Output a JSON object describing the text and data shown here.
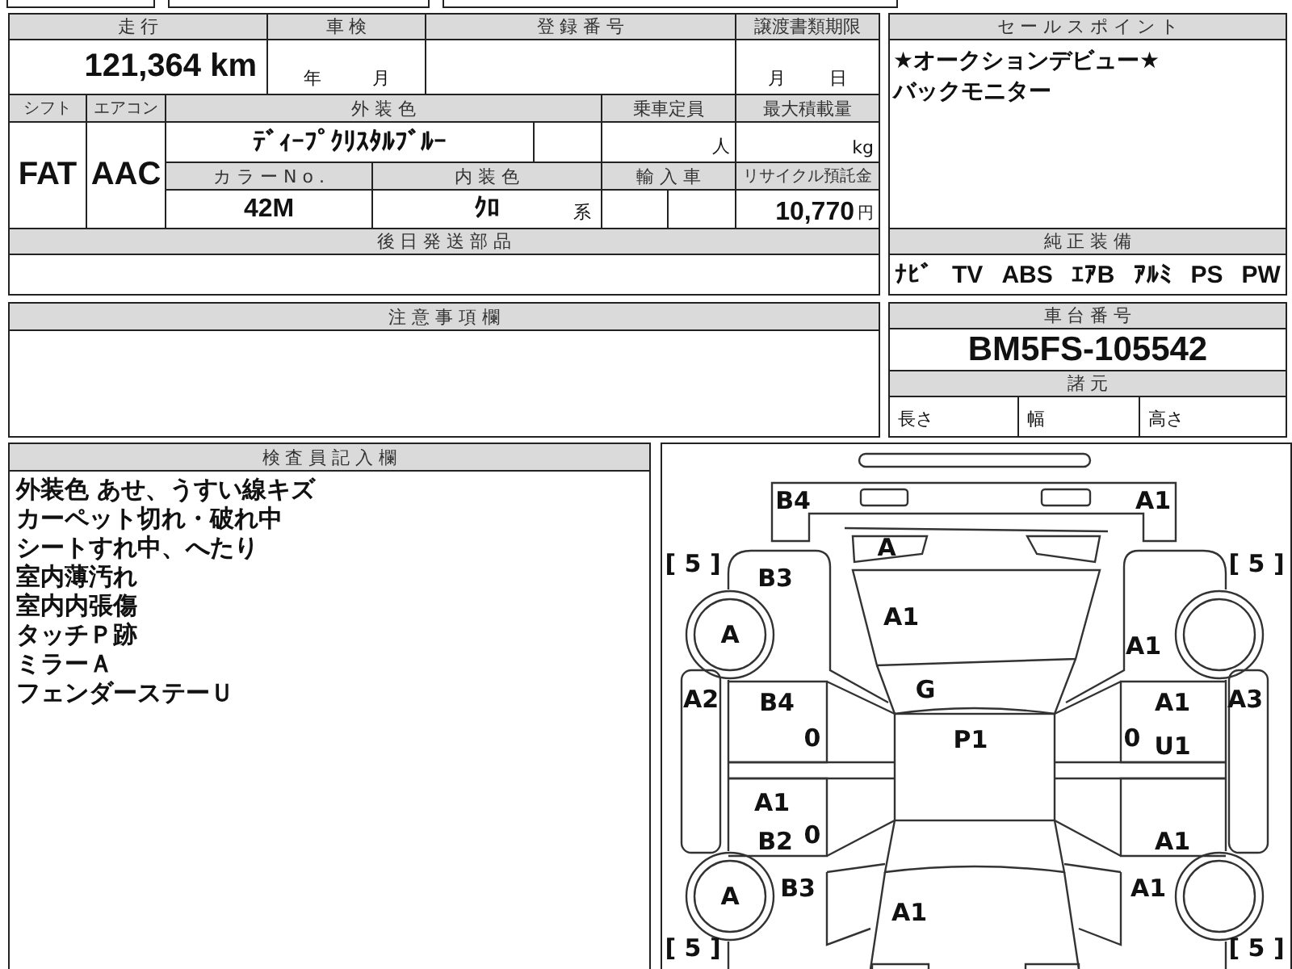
{
  "vehicle_table": {
    "mileage_label": "走 行",
    "mileage": "121,364 km",
    "inspection_label": "車 検",
    "inspection_year": "年",
    "inspection_month": "月",
    "registration_label": "登 録 番 号",
    "transfer_deadline_label": "譲渡書類期限",
    "transfer_month": "月",
    "transfer_day": "日",
    "shift_label": "シフト",
    "shift": "FAT",
    "ac_label": "エアコン",
    "ac": "AAC",
    "exterior_color_label": "外 装 色",
    "exterior_color": "ﾃﾞｨｰﾌﾟｸﾘｽﾀﾙﾌﾞﾙｰ",
    "capacity_label": "乗車定員",
    "capacity_unit": "人",
    "max_load_label": "最大積載量",
    "max_load_unit": "kg",
    "color_no_label": "カ ラ ー N o .",
    "color_no": "42M",
    "interior_color_label": "内 装 色",
    "interior_color": "ｸﾛ",
    "interior_suffix": "系",
    "import_label": "輸 入 車",
    "recycle_label": "リサイクル預託金",
    "recycle_fee": "10,770",
    "recycle_unit": "円",
    "later_parts_label": "後 日 発 送 部 品"
  },
  "sales_points": {
    "title": "セ ー ル ス ポ イ ン ト",
    "lines": [
      "★オークションデビュー★",
      "バックモニター"
    ]
  },
  "equipment": {
    "title": "純 正 装 備",
    "items": [
      "ﾅﾋﾞ",
      "TV",
      "ABS",
      "ｴｱB",
      "ｱﾙﾐ",
      "PS",
      "PW"
    ]
  },
  "notes": {
    "title": "注 意 事 項 欄"
  },
  "chassis": {
    "title": "車 台 番 号",
    "number": "BM5FS-105542",
    "specs_title": "諸 元",
    "specs": [
      "長さ",
      "幅",
      "高さ"
    ]
  },
  "inspector": {
    "title": "検 査 員 記 入 欄",
    "lines": [
      "外装色 あせ、うすい線キズ",
      "カーペット切れ・破れ中",
      "シートすれ中、へたり",
      "室内薄汚れ",
      "室内内張傷",
      "タッチＰ跡",
      "ミラーＡ",
      "フェンダーステーＵ"
    ]
  },
  "diagram": {
    "marks": [
      "B4",
      "A1",
      "A",
      "[ 5 ]",
      "[ 5 ]",
      "B3",
      "A",
      "A1",
      "A1",
      "A2",
      "B4",
      "G",
      "A1",
      "A3",
      "P1",
      "U1",
      "0",
      "0",
      "A1",
      "B2",
      "0",
      "A1",
      "B3",
      "A",
      "A1",
      "A1",
      "[ 5 ]",
      "[ 5 ]"
    ]
  }
}
